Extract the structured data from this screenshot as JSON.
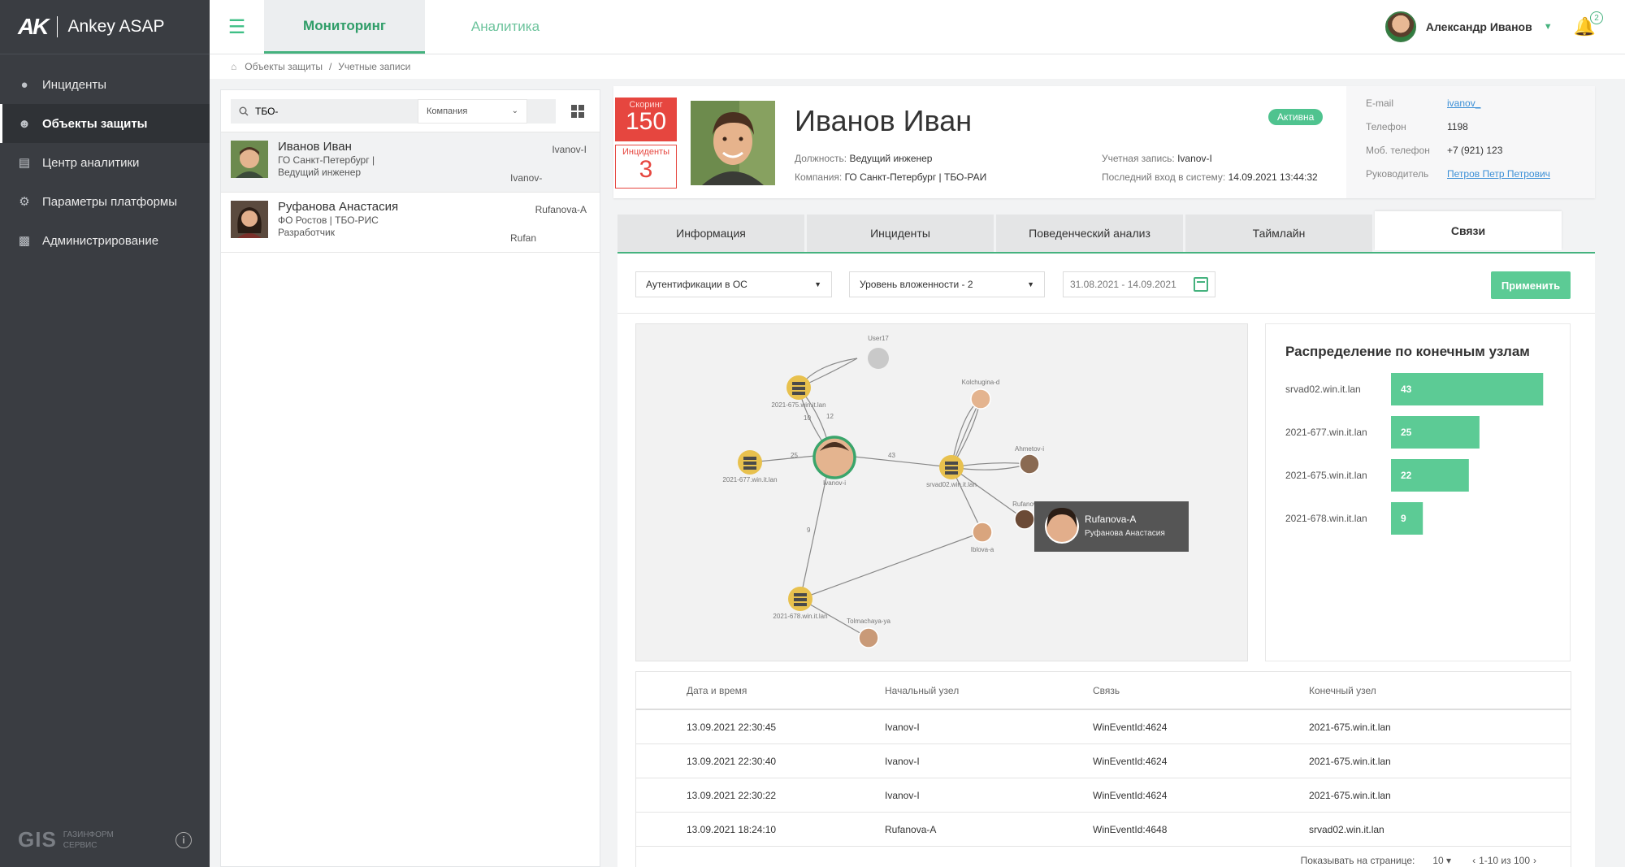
{
  "app": {
    "logo_mark": "AK",
    "name": "Ankey ASAP"
  },
  "sidebar": {
    "items": [
      {
        "label": "Инциденты",
        "icon": "shield-drop-icon"
      },
      {
        "label": "Объекты защиты",
        "icon": "users-icon"
      },
      {
        "label": "Центр аналитики",
        "icon": "chart-icon"
      },
      {
        "label": "Параметры платформы",
        "icon": "gears-icon"
      },
      {
        "label": "Администрирование",
        "icon": "admin-icon"
      }
    ],
    "footer": {
      "brand": "GIS",
      "brand_sub_1": "ГАЗИНФОРМ",
      "brand_sub_2": "СЕРВИС"
    }
  },
  "topbar": {
    "tabs": [
      "Мониторинг",
      "Аналитика"
    ],
    "user_name": "Александр Иванов",
    "notifications": "2"
  },
  "breadcrumb": [
    "Объекты защиты",
    "Учетные записи"
  ],
  "list": {
    "search_value": "ТБО-",
    "company_label": "Компания",
    "people": [
      {
        "name": "Иванов Иван",
        "org": "ГО Санкт-Петербург |",
        "role": "Ведущий инженер",
        "login": "Ivanov-I",
        "short": "Ivanov-"
      },
      {
        "name": "Руфанова Анастасия",
        "org": "ФО Ростов | ТБО-РИС",
        "role": "Разработчик",
        "login": "Rufanova-A",
        "short": "Rufan"
      }
    ]
  },
  "profile": {
    "score_label": "Скоринг",
    "score": "150",
    "incidents_label": "Инциденты",
    "incidents": "3",
    "name": "Иванов Иван",
    "status": "Активна",
    "position_label": "Должность:",
    "position": "Ведущий инженер",
    "company_label": "Компания:",
    "company": "ГО Санкт-Петербург | ТБО-РАИ",
    "account_label": "Учетная запись:",
    "account": "Ivanov-I",
    "last_login_label": "Последний вход в систему:",
    "last_login": "14.09.2021 13:44:32",
    "contacts": {
      "email_label": "E-mail",
      "email": "ivanov_",
      "phone_label": "Телефон",
      "phone": "1198",
      "mobile_label": "Моб. телефон",
      "mobile": "+7 (921) 123",
      "manager_label": "Руководитель",
      "manager": "Петров Петр Петрович"
    }
  },
  "tabs": [
    "Информация",
    "Инциденты",
    "Поведенческий анализ",
    "Таймлайн",
    "Связи"
  ],
  "filters": {
    "type": "Аутентификации в ОС",
    "depth": "Уровень вложенности - 2",
    "dates": "31.08.2021 - 14.09.2021",
    "apply": "Применить"
  },
  "graph": {
    "nodes": [
      {
        "label": "User17"
      },
      {
        "label": "2021-675.win.it.lan"
      },
      {
        "label": "Kolchugina-d"
      },
      {
        "label": "2021-677.win.it.lan"
      },
      {
        "label": "Ivanov-i"
      },
      {
        "label": "srvad02.win.it.lan"
      },
      {
        "label": "Ahmetov-i"
      },
      {
        "label": "Rufanov"
      },
      {
        "label": "Iblova-a"
      },
      {
        "label": "2021-678.win.it.lan"
      },
      {
        "label": "Tolmachaya-ya"
      }
    ],
    "edge_labels": [
      "10",
      "12",
      "25",
      "43",
      "9"
    ],
    "tooltip": {
      "login": "Rufanova-A",
      "name": "Руфанова Анастасия"
    }
  },
  "chart_data": {
    "type": "bar",
    "title": "Распределение по конечным узлам",
    "categories": [
      "srvad02.win.it.lan",
      "2021-677.win.it.lan",
      "2021-675.win.it.lan",
      "2021-678.win.it.lan"
    ],
    "values": [
      43,
      25,
      22,
      9
    ],
    "xlim": [
      0,
      45
    ],
    "color": "#5ccb95"
  },
  "table": {
    "headers": [
      "Дата и время",
      "Начальный узел",
      "Связь",
      "Конечный узел"
    ],
    "rows": [
      [
        "13.09.2021 22:30:45",
        "Ivanov-I",
        "WinEventId:4624",
        "2021-675.win.it.lan"
      ],
      [
        "13.09.2021 22:30:40",
        "Ivanov-I",
        "WinEventId:4624",
        "2021-675.win.it.lan"
      ],
      [
        "13.09.2021 22:30:22",
        "Ivanov-I",
        "WinEventId:4624",
        "2021-675.win.it.lan"
      ],
      [
        "13.09.2021 18:24:10",
        "Rufanova-A",
        "WinEventId:4648",
        "srvad02.win.it.lan"
      ]
    ],
    "pager": {
      "per_page_label": "Показывать на странице:",
      "per_page": "10",
      "range": "1-10 из 100"
    }
  }
}
